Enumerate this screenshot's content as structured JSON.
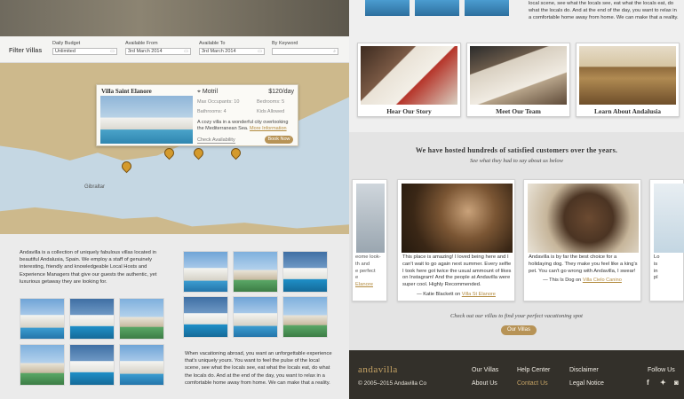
{
  "filter": {
    "title": "Filter Villas",
    "budget_label": "Daily Budget",
    "budget_value": "Unlimited",
    "from_label": "Available From",
    "from_value": "3rd March 2014",
    "to_label": "Available To",
    "to_value": "3rd March 2014",
    "keyword_label": "By Keyword",
    "keyword_value": ""
  },
  "map": {
    "labels": [
      "Motril",
      "Gibraltar"
    ]
  },
  "popup": {
    "name": "Villa Saint Elanore",
    "location": "Motril",
    "price": "$120/day",
    "occupants": "Max Occupants: 10",
    "bedrooms": "Bedrooms: 5",
    "bathrooms": "Bathrooms: 4",
    "kids": "Kids Allowed",
    "desc": "A cozy villa in a wonderful city overlooking the Mediterranean Sea.",
    "more": "More Information",
    "check": "Check Availability",
    "book": "Book Now"
  },
  "intro_text": "Andavilla is a collection of uniquely fabulous villas located in beautiful Andalusia, Spain. We employ a staff of genuinely interesting, friendly and knowledgeable Local Hosts and Experience Managers that give our guests the authentic, yet luxurious getaway they are looking for.",
  "intro2_text": "When vacationing abroad, you want an unforgettable experience that's uniquely yours. You want to feel the pulse of the local scene, see what the locals see, eat what the locals eat, do what the locals do. And at the end of the day, you want to relax in a comfortable home away from home. We can make that a reality.",
  "top_text": "local scene, see what the locals see, eat what the locals eat, do what the locals do. And at the end of the day, you want to relax in a comfortable home away from home. We can make that a reality.",
  "cards": [
    {
      "title": "Hear Our Story"
    },
    {
      "title": "Meet Our Team"
    },
    {
      "title": "Learn About Andalusia"
    }
  ],
  "testimonials": {
    "heading": "We have hosted hundreds of satisfied customers over the years.",
    "sub": "See what they had to say about us below",
    "items": [
      {
        "quote": "This place is amazing! I loved being here and I can't wait to go again next summer. Every selfie I took here got twice the usual ammount of likes on Instagram! And the people at Andavilla were super cool. Highly Recommended.",
        "author": "— Katie Blackett on",
        "villa": "Villa St Elanore"
      },
      {
        "quote": "Andavilla is by far the best choice for a holidaying dog. They make you feel like a king's pet. You can't go wrong with Andavilla, I swear!",
        "author": "— This Is Dog on",
        "villa": "Villa Cielo Canino"
      }
    ],
    "left_partial": [
      "eome look-",
      "th and",
      "e perfect",
      "e"
    ],
    "left_partial_villa": "Elanore",
    "right_partial": [
      "Lo",
      "is",
      "in",
      "pl"
    ]
  },
  "cta": {
    "text": "Check out our villas to find your perfect vacationing spot",
    "button": "Our Villas"
  },
  "footer": {
    "brand": "andavilla",
    "copy": "© 2005–2015 Andavilla Co",
    "links": [
      "Our Villas",
      "Help Center",
      "Disclaimer",
      "About Us",
      "Contact Us",
      "Legal Notice"
    ],
    "follow": "Follow Us",
    "social": [
      "facebook-icon",
      "twitter-icon",
      "instagram-icon"
    ]
  },
  "colors": {
    "accent": "#b79356",
    "footer_bg": "#33302a",
    "brand_gold": "#c7a465"
  }
}
